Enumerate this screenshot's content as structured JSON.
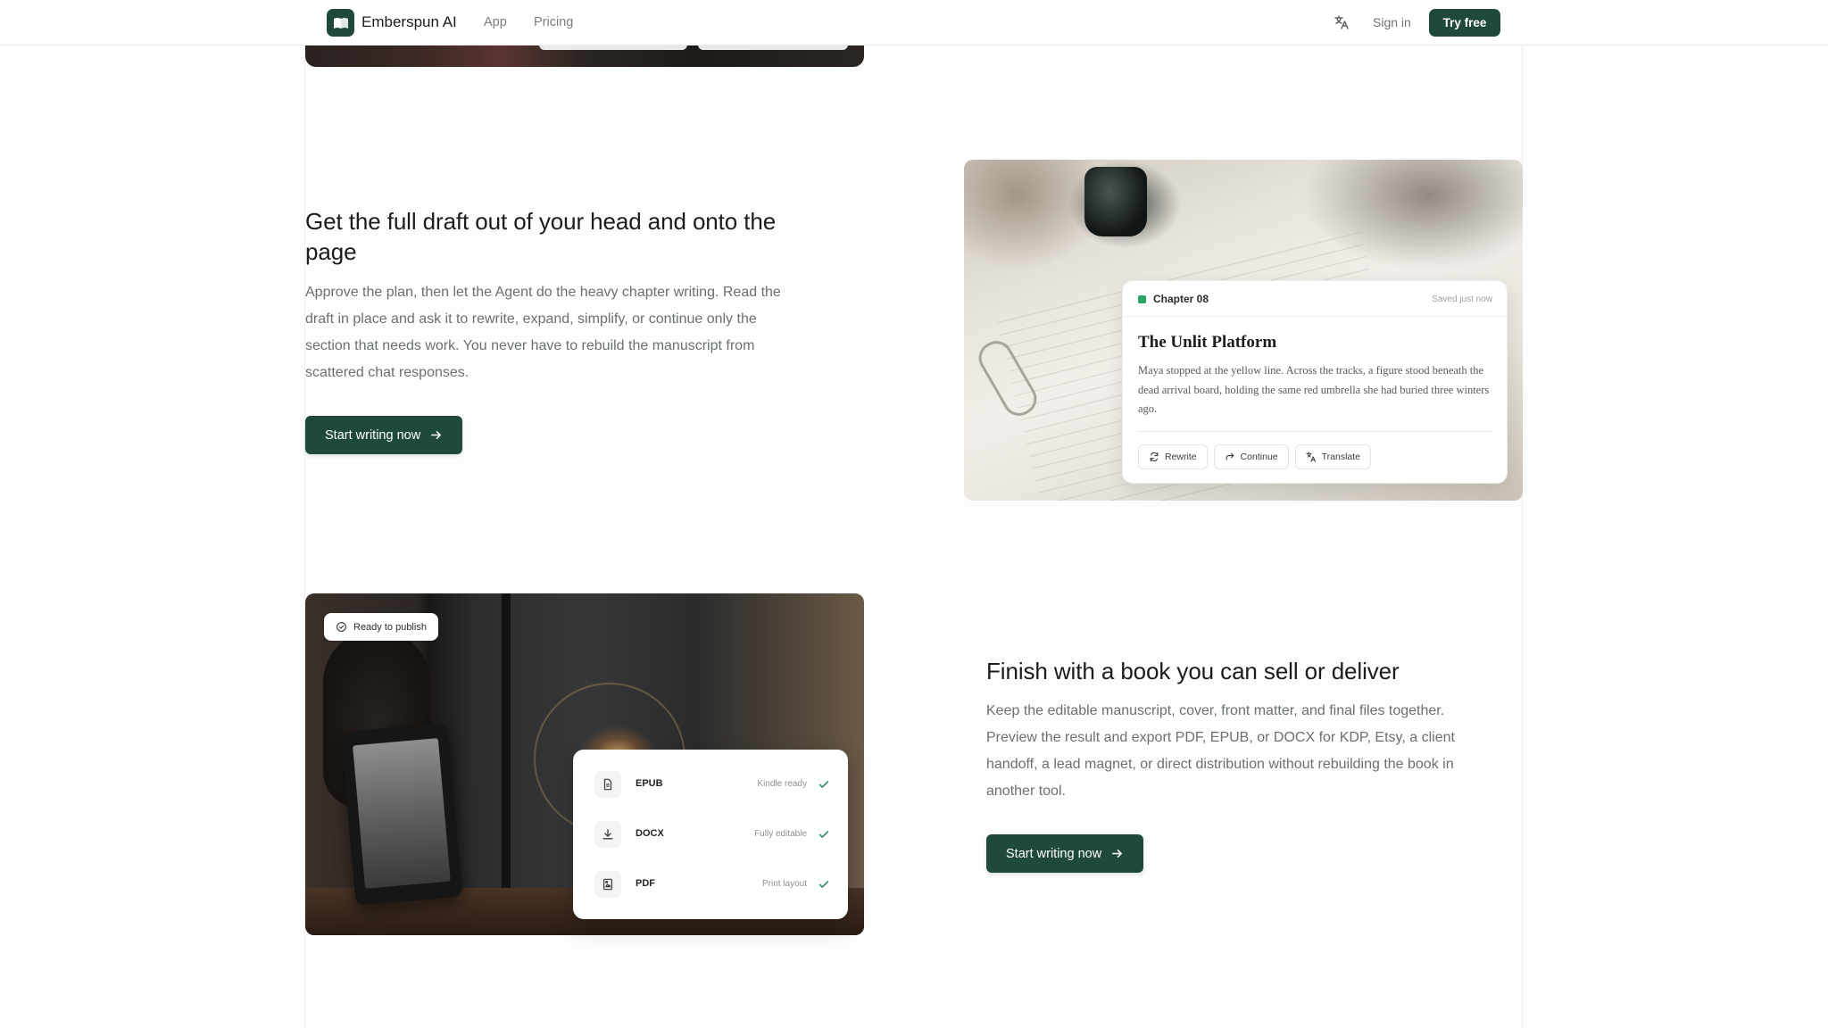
{
  "nav": {
    "brand": "Emberspun AI",
    "links": [
      "App",
      "Pricing"
    ],
    "sign_in": "Sign in",
    "try_free": "Try free"
  },
  "section_draft": {
    "heading": "Get the full draft out of your head and onto the page",
    "body": "Approve the plan, then let the Agent do the heavy chapter writing. Read the draft in place and ask it to rewrite, expand, simplify, or continue only the section that needs work. You never have to rebuild the manuscript from scattered chat responses.",
    "cta": "Start writing now",
    "card": {
      "chapter": "Chapter 08",
      "saved": "Saved just now",
      "title": "The Unlit Platform",
      "text": "Maya stopped at the yellow line. Across the tracks, a figure stood beneath the dead arrival board, holding the same red umbrella she had buried three winters ago.",
      "actions": [
        "Rewrite",
        "Continue",
        "Translate"
      ]
    }
  },
  "section_publish": {
    "heading": "Finish with a book you can sell or deliver",
    "body": "Keep the editable manuscript, cover, front matter, and final files together. Preview the result and export PDF, EPUB, or DOCX for KDP, Etsy, a client handoff, a lead magnet, or direct distribution without rebuilding the book in another tool.",
    "cta": "Start writing now",
    "badge": "Ready to publish",
    "exports": [
      {
        "name": "EPUB",
        "status": "Kindle ready",
        "icon": "file-icon"
      },
      {
        "name": "DOCX",
        "status": "Fully editable",
        "icon": "download-icon"
      },
      {
        "name": "PDF",
        "status": "Print layout",
        "icon": "pdf-icon"
      }
    ]
  },
  "colors": {
    "accent": "#1f4a3b",
    "status_green": "#2ba36a"
  }
}
